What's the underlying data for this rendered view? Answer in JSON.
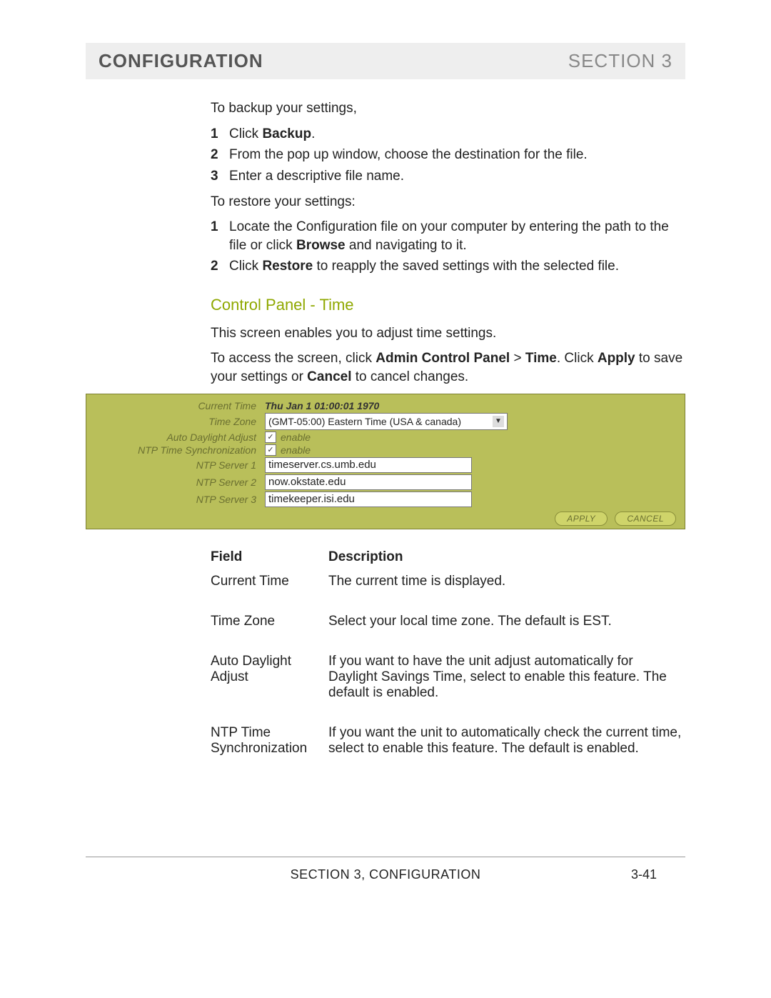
{
  "header": {
    "left": "CONFIGURATION",
    "right": "SECTION 3"
  },
  "intro_backup": "To backup your settings,",
  "backup_steps": [
    {
      "n": "1",
      "parts": [
        "Click ",
        "Backup",
        "."
      ]
    },
    {
      "n": "2",
      "text": "From the pop up window, choose the destination for the file."
    },
    {
      "n": "3",
      "text": "Enter a descriptive file name."
    }
  ],
  "intro_restore": "To restore your settings:",
  "restore_steps": [
    {
      "n": "1",
      "parts": [
        "Locate the Configuration file on your computer by entering the path to the file or click ",
        "Browse",
        " and navigating to it."
      ]
    },
    {
      "n": "2",
      "parts": [
        "Click ",
        "Restore",
        " to reapply the saved settings with the selected file."
      ]
    }
  ],
  "subheading": "Control Panel - Time",
  "desc1": "This screen enables you to adjust time settings.",
  "desc2_parts": [
    "To access the screen, click ",
    "Admin Control Panel",
    " > ",
    "Time",
    ". Click ",
    "Apply",
    " to save your settings or ",
    "Cancel",
    " to cancel changes."
  ],
  "panel": {
    "rows": {
      "current_time": {
        "label": "Current Time",
        "value": "Thu Jan 1 01:00:01 1970"
      },
      "time_zone": {
        "label": "Time Zone",
        "value": "(GMT-05:00) Eastern Time (USA & canada)"
      },
      "auto_dst": {
        "label": "Auto Daylight Adjust",
        "checklabel": "enable",
        "checked": true
      },
      "ntp_sync": {
        "label": "NTP Time Synchronization",
        "checklabel": "enable",
        "checked": true
      },
      "ntp1": {
        "label": "NTP Server 1",
        "value": "timeserver.cs.umb.edu"
      },
      "ntp2": {
        "label": "NTP Server 2",
        "value": "now.okstate.edu"
      },
      "ntp3": {
        "label": "NTP Server 3",
        "value": "timekeeper.isi.edu"
      }
    },
    "buttons": {
      "apply": "APPLY",
      "cancel": "CANCEL"
    }
  },
  "table": {
    "head": {
      "field": "Field",
      "desc": "Description"
    },
    "rows": [
      {
        "field": "Current Time",
        "desc": "The current time is displayed."
      },
      {
        "field": "Time Zone",
        "desc": "Select your local time zone. The default is EST."
      },
      {
        "field": "Auto Daylight Adjust",
        "desc": "If you want to have the unit adjust automatically for Daylight Savings Time, select to enable this feature. The default is enabled."
      },
      {
        "field": "NTP Time Synchronization",
        "desc": "If you want the unit to automatically check the current time, select to enable this feature. The default is enabled."
      }
    ]
  },
  "footer": {
    "center": "SECTION 3, CONFIGURATION",
    "right": "3-41"
  }
}
